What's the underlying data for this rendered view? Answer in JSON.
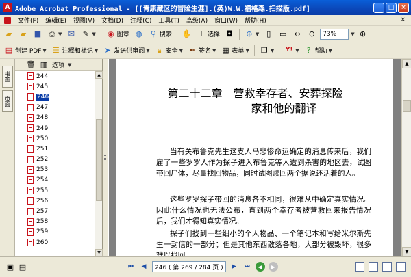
{
  "window": {
    "app_icon": "A",
    "title": "Adobe Acrobat Professional - [[青康藏区的冒险生涯].(英)W.W.福格森.扫描版.pdf]",
    "controls": [
      "_",
      "□",
      "×"
    ]
  },
  "menu": {
    "items": [
      "文件(F)",
      "编辑(E)",
      "视图(V)",
      "文档(D)",
      "注释(C)",
      "工具(T)",
      "高级(A)",
      "窗口(W)",
      "帮助(H)"
    ],
    "close_doc": "×"
  },
  "toolbar1": {
    "zoom_image_label": "图章",
    "search_label": "搜索",
    "select_label": "选择",
    "zoom_value": "73%"
  },
  "toolbar2": {
    "create_pdf": "创建 PDF",
    "comment_markup": "注释和标记",
    "send_review": "发送供审阅",
    "security": "安全",
    "sign": "签名",
    "forms": "表单",
    "help": "帮助"
  },
  "side_tabs": [
    "书签",
    "页面"
  ],
  "bookmarks": {
    "options_label": "选项",
    "items": [
      "244",
      "245",
      "246",
      "247",
      "248",
      "249",
      "250",
      "251",
      "252",
      "253",
      "254",
      "255",
      "256",
      "257",
      "258",
      "259",
      "260"
    ],
    "selected": "246"
  },
  "document": {
    "chapter_line1": "第二十二章　营救幸存者、安葬探险",
    "chapter_line2": "家和他的翻译",
    "para1": "当有关布鲁克先生这支人马悲惨命运确定的消息传来后，我们雇了一些罗罗人作为探子进入布鲁克等人遭到杀害的地区去，试图带回尸体，尽量找回物品，同时试图赎回两个据说还活着的人。",
    "para2": "这些罗罗探子带回的消息各不相同，很难从中确定真实情况。因此什么情况也无法公布，直到两个幸存者被营救回来报告情况后，我们才得知真实情况。",
    "para3": "探子们找到一些细小的个人物品、一个笔记本和写给米尔斯先生一封信的一部分；但是其他东西散落各地，大部分被毁坏，很多难以找回。"
  },
  "statusbar": {
    "page_value": "246 ( 第 269 / 284 页 )"
  },
  "colors": {
    "titlebar": "#0b47b8",
    "selection": "#0a3da8",
    "pdf_red": "#c8141c",
    "chrome": "#ece9d8"
  }
}
